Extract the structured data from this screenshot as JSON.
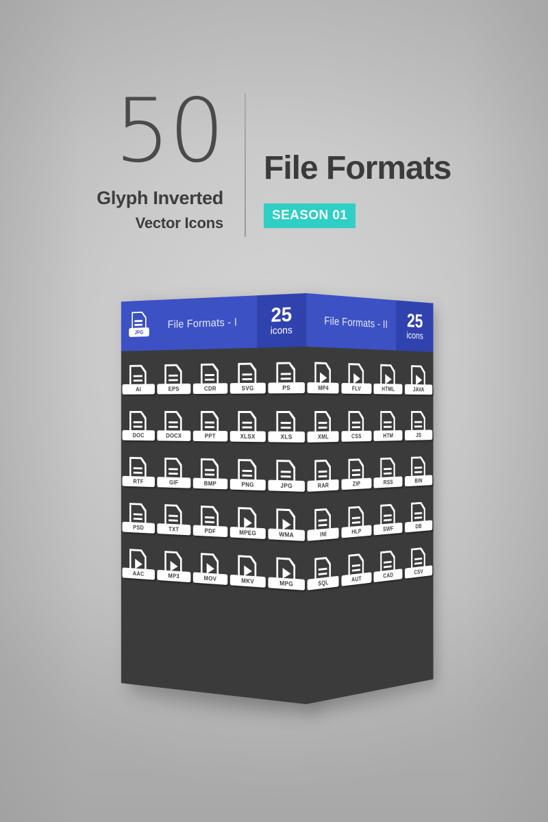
{
  "header": {
    "count": "50",
    "subtitle_1": "Glyph Inverted",
    "subtitle_2": "Vector Icons",
    "title": "File Formats",
    "season_badge": "SEASON 01",
    "accent_teal": "#2ecfc4",
    "accent_blue": "#3b51c4",
    "panel_dark": "#3b3b3b"
  },
  "panels": [
    {
      "id": "panel-1",
      "title": "File Formats - I",
      "count_number": "25",
      "count_label": "icons",
      "header_icon_label": "JPG",
      "rows": [
        [
          {
            "label": "Ai",
            "glyph": "lines"
          },
          {
            "label": "EPS",
            "glyph": "lines"
          },
          {
            "label": "CDR",
            "glyph": "lines"
          },
          {
            "label": "SVG",
            "glyph": "lines"
          },
          {
            "label": "PS",
            "glyph": "lines"
          }
        ],
        [
          {
            "label": "DOC",
            "glyph": "lines"
          },
          {
            "label": "DOCX",
            "glyph": "lines"
          },
          {
            "label": "PPT",
            "glyph": "lines"
          },
          {
            "label": "XLSX",
            "glyph": "lines"
          },
          {
            "label": "XLS",
            "glyph": "lines"
          }
        ],
        [
          {
            "label": "RTF",
            "glyph": "lines"
          },
          {
            "label": "GIF",
            "glyph": "lines"
          },
          {
            "label": "BMP",
            "glyph": "lines"
          },
          {
            "label": "PNG",
            "glyph": "lines"
          },
          {
            "label": "JPG",
            "glyph": "lines"
          }
        ],
        [
          {
            "label": "PSD",
            "glyph": "lines"
          },
          {
            "label": "TXT",
            "glyph": "lines"
          },
          {
            "label": "PDF",
            "glyph": "lines"
          },
          {
            "label": "MPEG",
            "glyph": "play"
          },
          {
            "label": "WMA",
            "glyph": "play"
          }
        ],
        [
          {
            "label": "AAC",
            "glyph": "play"
          },
          {
            "label": "MP3",
            "glyph": "play"
          },
          {
            "label": "MOV",
            "glyph": "play"
          },
          {
            "label": "MKV",
            "glyph": "play"
          },
          {
            "label": "MPG",
            "glyph": "play"
          }
        ]
      ]
    },
    {
      "id": "panel-2",
      "title": "File Formats - II",
      "count_number": "25",
      "count_label": "icons",
      "header_icon_label": "",
      "rows": [
        [
          {
            "label": "MP4",
            "glyph": "play"
          },
          {
            "label": "FLV",
            "glyph": "play"
          },
          {
            "label": "HTML",
            "glyph": "play"
          },
          {
            "label": "JAVA",
            "glyph": "play"
          }
        ],
        [
          {
            "label": "XML",
            "glyph": "lines"
          },
          {
            "label": "CSS",
            "glyph": "lines"
          },
          {
            "label": "HTM",
            "glyph": "lines"
          },
          {
            "label": "JS",
            "glyph": "lines"
          }
        ],
        [
          {
            "label": "RAR",
            "glyph": "lines"
          },
          {
            "label": "ZIP",
            "glyph": "lines"
          },
          {
            "label": "RSS",
            "glyph": "lines"
          },
          {
            "label": "BIN",
            "glyph": "lines"
          }
        ],
        [
          {
            "label": "INI",
            "glyph": "lines"
          },
          {
            "label": "HLP",
            "glyph": "lines"
          },
          {
            "label": "SWF",
            "glyph": "lines"
          },
          {
            "label": "DB",
            "glyph": "lines"
          }
        ],
        [
          {
            "label": "SQL",
            "glyph": "lines"
          },
          {
            "label": "AUT",
            "glyph": "lines"
          },
          {
            "label": "CAD",
            "glyph": "lines"
          },
          {
            "label": "CSV",
            "glyph": "lines"
          }
        ]
      ]
    }
  ]
}
